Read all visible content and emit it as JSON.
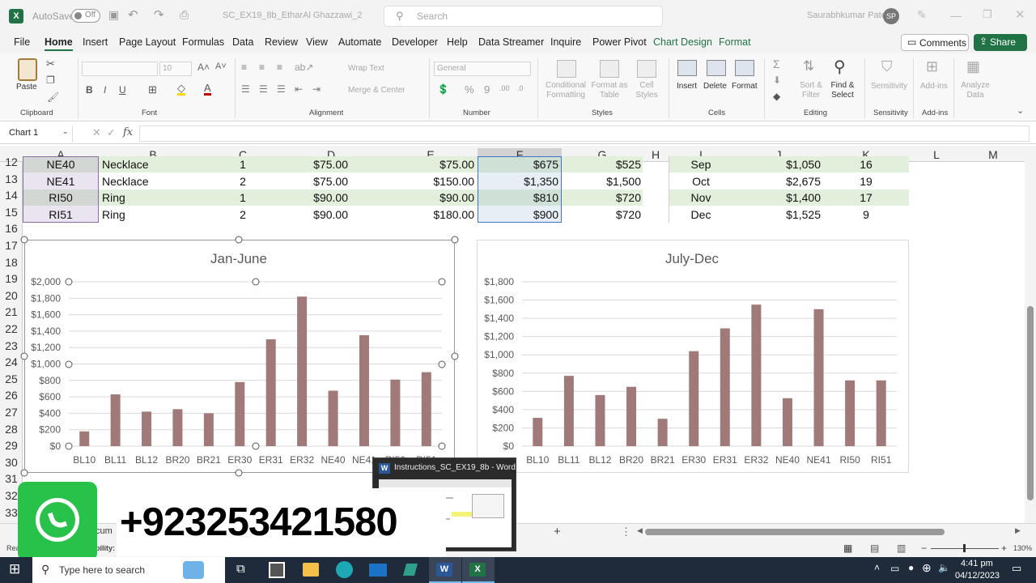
{
  "app": {
    "autosave": "AutoSave",
    "autosave_state": "Off",
    "filename": "SC_EX19_8b_EtharAl Ghazzawi_2",
    "search": "Search",
    "user": "Saurabhkumar Patel",
    "initials": "SP"
  },
  "tabs": [
    "File",
    "Home",
    "Insert",
    "Page Layout",
    "Formulas",
    "Data",
    "Review",
    "View",
    "Automate",
    "Developer",
    "Help",
    "Data Streamer",
    "Inquire",
    "Power Pivot",
    "Chart Design",
    "Format"
  ],
  "buttons": {
    "comments": "Comments",
    "share": "Share"
  },
  "ribbon": {
    "paste": "Paste",
    "clipboard": "Clipboard",
    "font": "Font",
    "font_size": "10",
    "alignment": "Alignment",
    "wrap": "Wrap Text",
    "merge": "Merge & Center",
    "number": "Number",
    "number_format": "General",
    "cond": "Conditional Formatting",
    "fmt_table": "Format as Table",
    "cell_styles": "Cell Styles",
    "styles": "Styles",
    "insert": "Insert",
    "delete": "Delete",
    "format": "Format",
    "cells": "Cells",
    "sort": "Sort & Filter",
    "find": "Find & Select",
    "editing": "Editing",
    "sensitivity": "Sensitivity",
    "addins": "Add-ins",
    "analyze": "Analyze Data"
  },
  "namebox": "Chart 1",
  "fx": "fx",
  "columns": [
    "A",
    "B",
    "C",
    "D",
    "E",
    "F",
    "G",
    "H",
    "I",
    "J",
    "K",
    "L",
    "M"
  ],
  "rows": [
    "12",
    "13",
    "14",
    "15",
    "16",
    "17",
    "18",
    "19",
    "20",
    "21",
    "22",
    "23",
    "24",
    "25",
    "26",
    "27",
    "28",
    "29",
    "30",
    "31",
    "32",
    "33"
  ],
  "table1": [
    {
      "a": "NE40",
      "b": "Necklace",
      "c": "1",
      "d": "$75.00",
      "e": "$75.00",
      "f": "$675",
      "g": "$525"
    },
    {
      "a": "NE41",
      "b": "Necklace",
      "c": "2",
      "d": "$75.00",
      "e": "$150.00",
      "f": "$1,350",
      "g": "$1,500"
    },
    {
      "a": "RI50",
      "b": "Ring",
      "c": "1",
      "d": "$90.00",
      "e": "$90.00",
      "f": "$810",
      "g": "$720"
    },
    {
      "a": "RI51",
      "b": "Ring",
      "c": "2",
      "d": "$90.00",
      "e": "$180.00",
      "f": "$900",
      "g": "$720"
    }
  ],
  "table2": [
    {
      "i": "Sep",
      "j": "$1,050",
      "k": "16"
    },
    {
      "i": "Oct",
      "j": "$2,675",
      "k": "19"
    },
    {
      "i": "Nov",
      "j": "$1,400",
      "k": "17"
    },
    {
      "i": "Dec",
      "j": "$1,525",
      "k": "9"
    }
  ],
  "chart_data": [
    {
      "type": "bar",
      "title": "Jan-June",
      "categories": [
        "BL10",
        "BL11",
        "BL12",
        "BR20",
        "BR21",
        "ER30",
        "ER31",
        "ER32",
        "NE40",
        "NE41",
        "RI50",
        "RI51"
      ],
      "values": [
        180,
        630,
        420,
        450,
        400,
        780,
        1300,
        1820,
        675,
        1350,
        810,
        900
      ],
      "ylim": [
        0,
        2000
      ],
      "yticks": [
        "$0",
        "$200",
        "$400",
        "$600",
        "$800",
        "$1,000",
        "$1,200",
        "$1,400",
        "$1,600",
        "$1,800",
        "$2,000"
      ],
      "color": "#a07a78",
      "grid": true
    },
    {
      "type": "bar",
      "title": "July-Dec",
      "categories": [
        "BL10",
        "BL11",
        "BL12",
        "BR20",
        "BR21",
        "ER30",
        "ER31",
        "ER32",
        "NE40",
        "NE41",
        "RI50",
        "RI51"
      ],
      "values": [
        310,
        770,
        560,
        650,
        300,
        1040,
        1290,
        1550,
        525,
        1500,
        720,
        720
      ],
      "ylim": [
        0,
        1800
      ],
      "yticks": [
        "$0",
        "$200",
        "$400",
        "$600",
        "$800",
        "$1,000",
        "$1,200",
        "$1,400",
        "$1,600",
        "$1,800"
      ],
      "color": "#a07a78",
      "grid": true
    }
  ],
  "popup": {
    "title": "Instructions_SC_EX19_8b - Word"
  },
  "overlay": {
    "phone": "+923253421580"
  },
  "status": {
    "left": "Rea",
    "accessibility": "bility: I",
    "docu": "cum",
    "zoom": "130%"
  },
  "taskbar": {
    "search": "Type here to search",
    "time": "4:41 pm",
    "date": "04/12/2023"
  },
  "colors": {
    "excel_green": "#217346",
    "bar": "#a07a78",
    "select_border": "#8c6da5"
  }
}
